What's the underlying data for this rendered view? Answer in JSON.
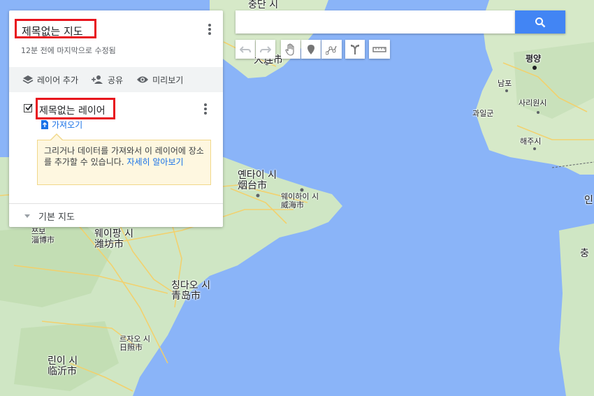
{
  "map": {
    "labels": {
      "dalian": {
        "ko": "다롄 시",
        "han": "大连市"
      },
      "yantai": {
        "ko": "옌타이 시",
        "han": "烟台市"
      },
      "weihai": {
        "ko": "웨이하이 시",
        "han": "威海市"
      },
      "weifang": {
        "ko": "웨이팡 시",
        "han": "潍坊市"
      },
      "zibo": {
        "ko": "쯔보",
        "han": "淄博市"
      },
      "qingdao": {
        "ko": "칭다오 시",
        "han": "青岛市"
      },
      "rizhao": {
        "ko": "르자오 시",
        "han": "日照市"
      },
      "linyi": {
        "ko": "린이 시",
        "han": "临沂市"
      },
      "pyongyang": "평양",
      "nampo": "남포",
      "kwail": "과일군",
      "sariwon": "사리원시",
      "haeju": "해주시",
      "incheon_partial": "인",
      "chungcheong_partial": "충",
      "top_partial": "중단 시"
    }
  },
  "panel": {
    "map_title": "제목없는 지도",
    "last_edit": "12분 전에 마지막으로 수정됨",
    "toolbar": {
      "add_layer": "레이어 추가",
      "share": "공유",
      "preview": "미리보기"
    },
    "layer": {
      "title": "제목없는 레이어",
      "import": "가져오기",
      "tip_text": "그리거나 데이터를 가져와서 이 레이어에 장소를 추가할 수 있습니다. ",
      "tip_link": "자세히 알아보기"
    },
    "base_map": "기본 지도"
  },
  "search": {
    "placeholder": ""
  },
  "tools": [
    "undo-icon",
    "redo-icon",
    "hand-icon",
    "marker-icon",
    "line-icon",
    "directions-icon",
    "ruler-icon"
  ],
  "colors": {
    "sea": "#8ab4f8",
    "land": "#cfe6c4",
    "highlight": "#e8141d",
    "accent": "#4285f4"
  }
}
